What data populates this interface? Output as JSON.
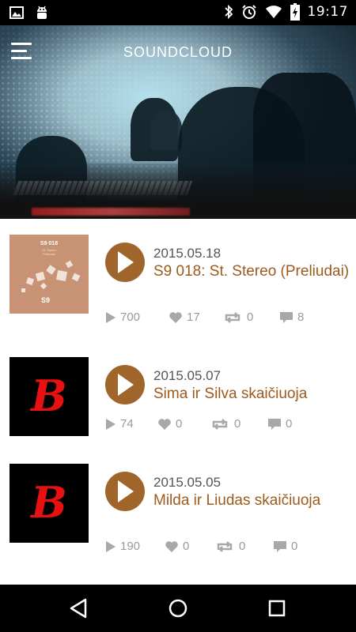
{
  "status_bar": {
    "time": "19:17"
  },
  "header": {
    "title": "SOUNDCLOUD"
  },
  "tracks": [
    {
      "date": "2015.05.18",
      "title": "S9 018: St. Stereo (Preliudai)",
      "plays": "700",
      "likes": "17",
      "reposts": "0",
      "comments": "8",
      "artwork": {
        "type": "album",
        "label": "S9 018",
        "sub": "St. Stereo\nPreliudai",
        "color": "#c89274"
      }
    },
    {
      "date": "2015.05.07",
      "title": "Sima ir Silva skaičiuoja",
      "plays": "74",
      "likes": "0",
      "reposts": "0",
      "comments": "0",
      "artwork": {
        "type": "logo",
        "glyph": "B",
        "color": "#e81010"
      }
    },
    {
      "date": "2015.05.05",
      "title": "Milda ir Liudas skaičiuoja",
      "plays": "190",
      "likes": "0",
      "reposts": "0",
      "comments": "0",
      "artwork": {
        "type": "logo",
        "glyph": "B",
        "color": "#e81010"
      }
    }
  ],
  "colors": {
    "accent": "#a0652a",
    "title_text": "#9c5a1c",
    "stat_gray": "#999999"
  },
  "icons": {
    "menu": "menu-icon",
    "play": "play-icon",
    "plays": "play-count-icon",
    "likes": "heart-icon",
    "reposts": "repost-icon",
    "comments": "comment-icon"
  }
}
